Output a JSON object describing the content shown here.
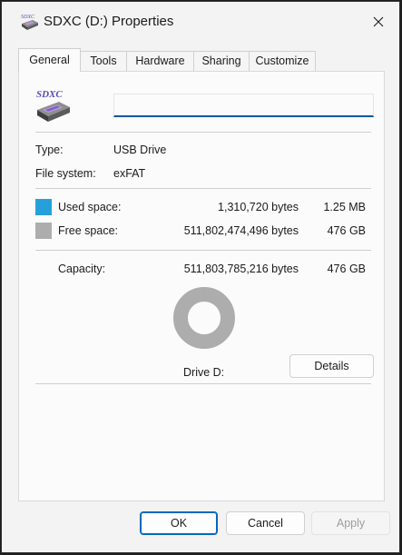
{
  "window": {
    "title": "SDXC (D:) Properties",
    "close_icon": "close-icon"
  },
  "tabs": [
    {
      "label": "General",
      "active": true
    },
    {
      "label": "Tools",
      "active": false
    },
    {
      "label": "Hardware",
      "active": false
    },
    {
      "label": "Sharing",
      "active": false
    },
    {
      "label": "Customize",
      "active": false
    }
  ],
  "general": {
    "drive_icon_label": "SDXC",
    "name_value": "",
    "type_label": "Type:",
    "type_value": "USB Drive",
    "filesystem_label": "File system:",
    "filesystem_value": "exFAT",
    "used": {
      "label": "Used space:",
      "bytes": "1,310,720 bytes",
      "size": "1.25 MB",
      "color": "#26a0da"
    },
    "free": {
      "label": "Free space:",
      "bytes": "511,802,474,496 bytes",
      "size": "476 GB",
      "color": "#adadad"
    },
    "capacity": {
      "label": "Capacity:",
      "bytes": "511,803,785,216 bytes",
      "size": "476 GB"
    },
    "used_fraction": 2.6e-06,
    "drive_label": "Drive D:",
    "details_button": "Details"
  },
  "buttons": {
    "ok": "OK",
    "cancel": "Cancel",
    "apply": "Apply"
  }
}
